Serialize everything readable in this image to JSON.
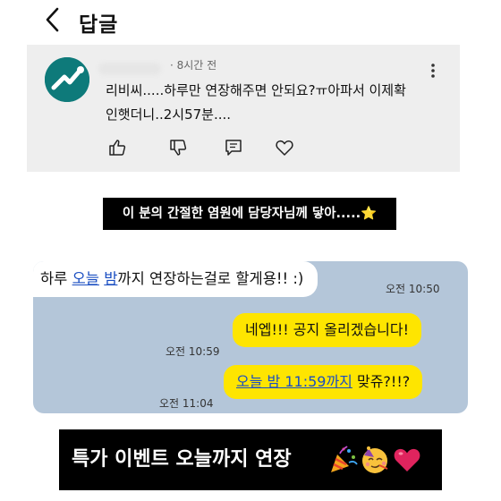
{
  "header": {
    "title": "답글"
  },
  "comment": {
    "meta": "· 8시간 전",
    "lines": [
      "리비씨.....하루만 연장해주면 안되요?ㅠ아파서 이제확",
      "인햇더니..2시57분...."
    ]
  },
  "caption": {
    "text": "이 분의 간절한 염원에 담당자님께 닿아.....⭐"
  },
  "chat": {
    "left_message": {
      "prefix": "하루 ",
      "link1": "오늘",
      "space": " ",
      "link2": "밤",
      "suffix": "까지 연장하는걸로 할게용!! :)"
    },
    "left_time": "오전 10:50",
    "right_message_1": "네엡!!! 공지 올리겠습니다!",
    "right_time_1": "오전 10:59",
    "right_message_2": {
      "link": "오늘 밤 11:59까지",
      "suffix": " 맞쥬?!!?"
    },
    "right_time_2": "오전 11:04"
  },
  "bottom_banner": {
    "text": "특가 이벤트 오늘까지 연장",
    "emojis": [
      "party-popper-icon",
      "partying-face-icon",
      "red-heart-icon"
    ]
  },
  "colors": {
    "chat_bg": "#b4c6d9",
    "yellow_bubble": "#fee500",
    "link": "#1a4ec2",
    "avatar": "#0e7a7a"
  }
}
